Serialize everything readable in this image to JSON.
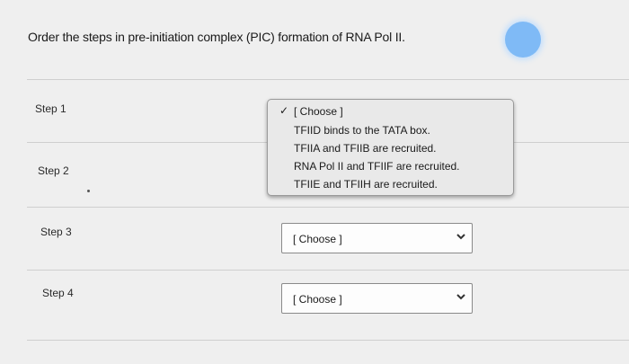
{
  "question": {
    "text": "Order the steps in pre-initiation complex (PIC) formation of RNA Pol II."
  },
  "steps": [
    {
      "label": "Step 1"
    },
    {
      "label": "Step 2"
    },
    {
      "label": "Step 3"
    },
    {
      "label": "Step 4"
    }
  ],
  "dropdown": {
    "options": [
      "[ Choose ]",
      "TFIID binds to the TATA box.",
      "TFIIA and TFIIB are recruited.",
      "RNA Pol II and TFIIF are recruited.",
      "TFIIE and TFIIH are recruited."
    ],
    "selected_index": 0
  },
  "selects": {
    "step3_value": "[ Choose ]",
    "step4_value": "[ Choose ]"
  },
  "colors": {
    "accent_dot": "#7fbaf6",
    "background": "#efefef"
  }
}
